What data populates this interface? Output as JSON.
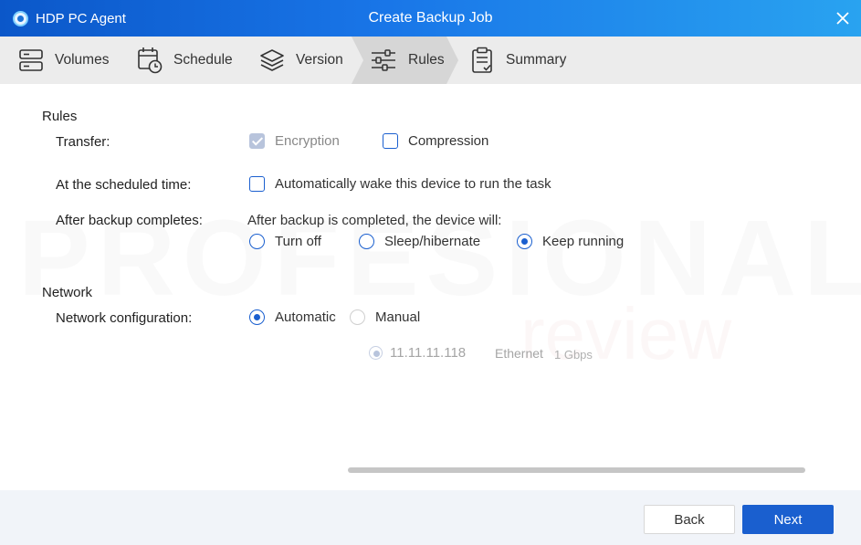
{
  "window": {
    "app_name": "HDP PC Agent",
    "title": "Create Backup Job",
    "accent": "#1a5fcf"
  },
  "steps": [
    {
      "label": "Volumes",
      "icon": "server-icon"
    },
    {
      "label": "Schedule",
      "icon": "calendar-clock-icon"
    },
    {
      "label": "Version",
      "icon": "layers-icon"
    },
    {
      "label": "Rules",
      "icon": "sliders-icon",
      "active": true
    },
    {
      "label": "Summary",
      "icon": "clipboard-check-icon"
    }
  ],
  "rules": {
    "section_title": "Rules",
    "transfer": {
      "label": "Transfer:",
      "encryption": {
        "label": "Encryption",
        "checked": true,
        "disabled": true
      },
      "compression": {
        "label": "Compression",
        "checked": false
      }
    },
    "scheduled": {
      "label": "At the scheduled time:",
      "wake": {
        "label": "Automatically wake this device to run the task",
        "checked": false
      }
    },
    "after_backup": {
      "label": "After backup completes:",
      "description": "After backup is completed, the device will:",
      "options": [
        "Turn off",
        "Sleep/hibernate",
        "Keep running"
      ],
      "selected": "Keep running"
    }
  },
  "network": {
    "section_title": "Network",
    "config_label": "Network configuration:",
    "options": [
      "Automatic",
      "Manual"
    ],
    "selected": "Automatic",
    "interface": {
      "ip": "11.11.11.118",
      "name": "Ethernet",
      "speed": "1 Gbps"
    }
  },
  "footer": {
    "back_label": "Back",
    "next_label": "Next"
  }
}
